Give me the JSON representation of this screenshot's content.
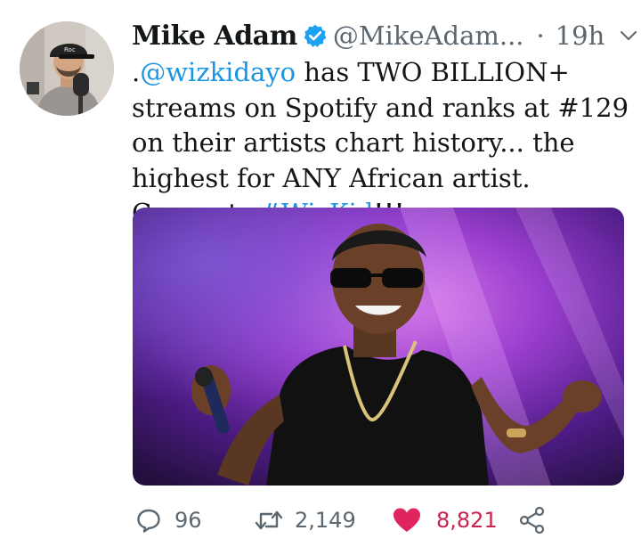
{
  "tweet": {
    "author": {
      "name": "Mike Adam",
      "handle": "@MikeAdam...",
      "verified": true,
      "avatar_icon": "profile-photo"
    },
    "separator": "·",
    "timestamp": "19h",
    "menu_icon": "chevron-down-icon",
    "text": {
      "prefix": ".",
      "mention": "@wizkidayo",
      "body": " has TWO BILLION+ streams on Spotify and ranks at #129 on their artists chart history... the highest for ANY African artist. Congrats ",
      "hashtag": "#WizKid",
      "suffix": "!!!"
    },
    "media": {
      "type": "photo",
      "icon": "performer-photo"
    },
    "actions": {
      "replies": "96",
      "retweets": "2,149",
      "likes": "8,821",
      "liked": true,
      "share_icon": "share-icon"
    },
    "colors": {
      "link": "#1b95e0",
      "verified": "#1da1f2",
      "like": "#e0245e",
      "muted": "#5b6770"
    }
  }
}
